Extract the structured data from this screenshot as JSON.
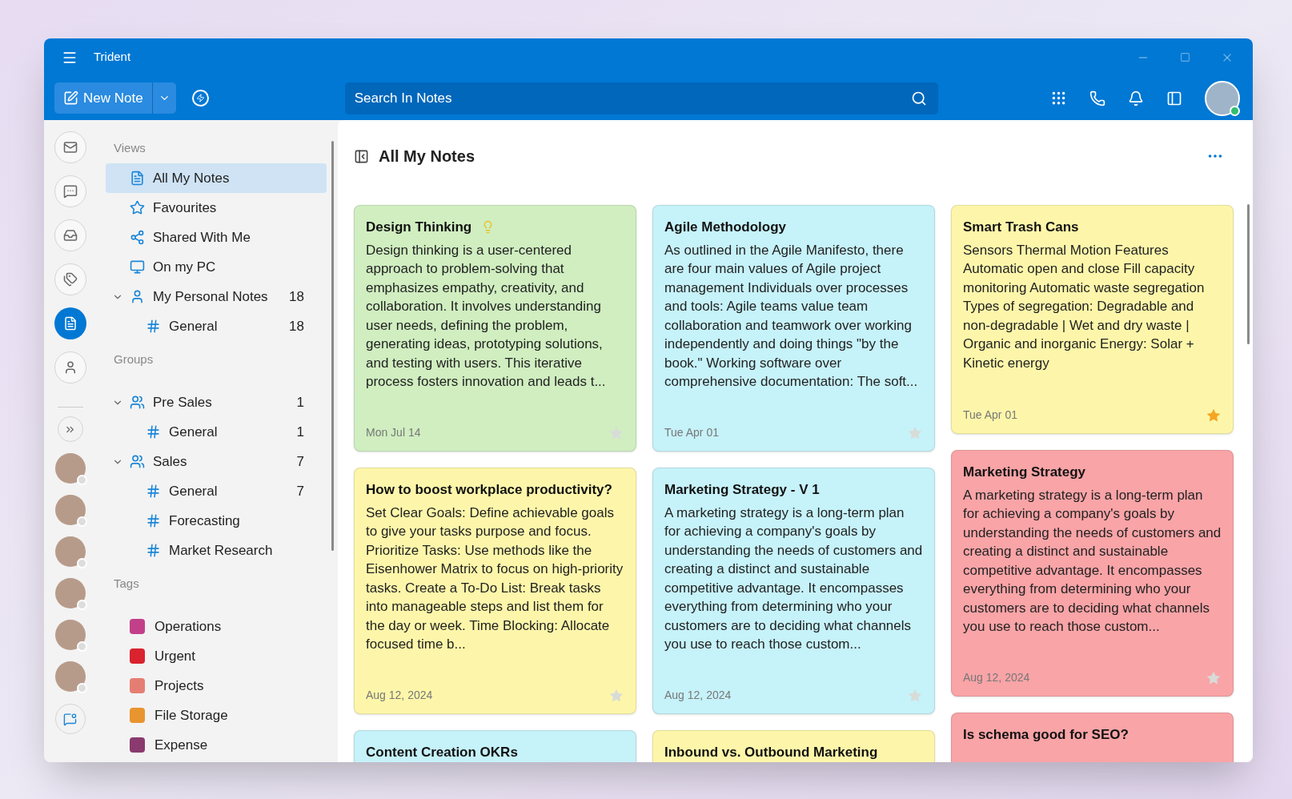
{
  "window": {
    "title": "Trident"
  },
  "toolbar": {
    "new_note": "New Note",
    "search": {
      "placeholder": "Search In Notes"
    }
  },
  "rail": [
    {
      "kind": "mail",
      "selected": false
    },
    {
      "kind": "chat",
      "selected": false
    },
    {
      "kind": "archive",
      "selected": false
    },
    {
      "kind": "tags",
      "selected": false
    },
    {
      "kind": "notes",
      "selected": true
    },
    {
      "kind": "contacts",
      "selected": false
    }
  ],
  "sidebar": {
    "views": {
      "heading": "Views",
      "items": [
        {
          "kind": "notes",
          "label": "All My Notes",
          "selected": true
        },
        {
          "kind": "star",
          "label": "Favourites",
          "selected": false
        },
        {
          "kind": "share",
          "label": "Shared With Me",
          "selected": false
        },
        {
          "kind": "pc",
          "label": "On my PC",
          "selected": false
        },
        {
          "kind": "person",
          "label": "My Personal Notes",
          "count": "18",
          "selected": false,
          "expanded": true,
          "children": [
            {
              "label": "General",
              "count": "18",
              "selected": false
            }
          ]
        }
      ]
    },
    "groups": {
      "heading": "Groups",
      "items": [
        {
          "label": "Pre Sales",
          "count": "1",
          "selected": false,
          "expanded": true,
          "children": [
            {
              "label": "General",
              "count": "1",
              "selected": false
            }
          ]
        },
        {
          "label": "Sales",
          "count": "7",
          "selected": false,
          "expanded": true,
          "children": [
            {
              "label": "General",
              "count": "7",
              "selected": false
            },
            {
              "label": "Forecasting",
              "selected": false
            },
            {
              "label": "Market Research",
              "selected": false
            }
          ]
        }
      ]
    },
    "tags": {
      "heading": "Tags",
      "items": [
        {
          "label": "Operations",
          "color": "#c2408a"
        },
        {
          "label": "Urgent",
          "color": "#d9232e"
        },
        {
          "label": "Projects",
          "color": "#e57e72"
        },
        {
          "label": "File Storage",
          "color": "#e8952f"
        },
        {
          "label": "Expense",
          "color": "#8a3a6e"
        }
      ]
    }
  },
  "main": {
    "title": "All My Notes",
    "columns": [
      [
        {
          "title": "Design Thinking",
          "idea": true,
          "body": "Design thinking is a user-centered approach to problem-solving that emphasizes empathy, creativity, and collaboration. It involves understanding user needs, defining the problem, generating ideas, prototyping solutions, and testing with users. This iterative process fosters innovation and leads t...",
          "date": "Mon Jul 14",
          "color": "#d0eec0",
          "starred": false
        },
        {
          "title": "How to boost workplace productivity?",
          "idea": false,
          "body": "Set Clear Goals: Define achievable goals to give your tasks purpose and focus. Prioritize Tasks: Use methods like the Eisenhower Matrix to focus on high-priority tasks. Create a To-Do List: Break tasks into manageable steps and list them for the day or week. Time Blocking: Allocate focused time b...",
          "date": "Aug 12, 2024",
          "color": "#fdf6aa",
          "starred": false
        },
        {
          "title": "Content Creation OKRs",
          "color": "#c6f2f9"
        }
      ],
      [
        {
          "title": "Agile Methodology",
          "idea": false,
          "body": "As outlined in the Agile Manifesto, there are four main values of Agile project management Individuals over processes and tools: Agile teams value team collaboration and teamwork over working independently and doing things \"by the book.\" Working software over comprehensive documentation: The soft...",
          "date": "Tue Apr 01",
          "color": "#c6f2f9",
          "starred": false
        },
        {
          "title": "Marketing Strategy - V 1",
          "idea": false,
          "body": "A marketing strategy is a long-term plan for achieving a company's goals by understanding the needs of customers and creating a distinct and sustainable competitive advantage. It encompasses everything from determining who your customers are to deciding what channels you use to reach those custom...",
          "date": "Aug 12, 2024",
          "color": "#c6f2f9",
          "starred": false
        },
        {
          "title": "Inbound vs. Outbound Marketing",
          "color": "#fdf6aa"
        }
      ],
      [
        {
          "title": "Smart Trash Cans",
          "idea": false,
          "body": "Sensors Thermal Motion Features Automatic open and close Fill capacity monitoring Automatic waste segregation Types of segregation: Degradable and non-degradable | Wet and dry waste | Organic and inorganic Energy: Solar + Kinetic energy",
          "date": "Tue Apr 01",
          "color": "#fdf6aa",
          "starred": true
        },
        {
          "title": "Marketing Strategy",
          "idea": false,
          "body": "A marketing strategy is a long-term plan for achieving a company's goals by understanding the needs of customers and creating a distinct and sustainable competitive advantage. It encompasses everything from determining who your customers are to deciding what channels you use to reach those custom...",
          "date": "Aug 12, 2024",
          "color": "#f9a4a7",
          "starred": false
        },
        {
          "title": "Is schema good for SEO?",
          "color": "#f9a4a7"
        }
      ]
    ]
  }
}
